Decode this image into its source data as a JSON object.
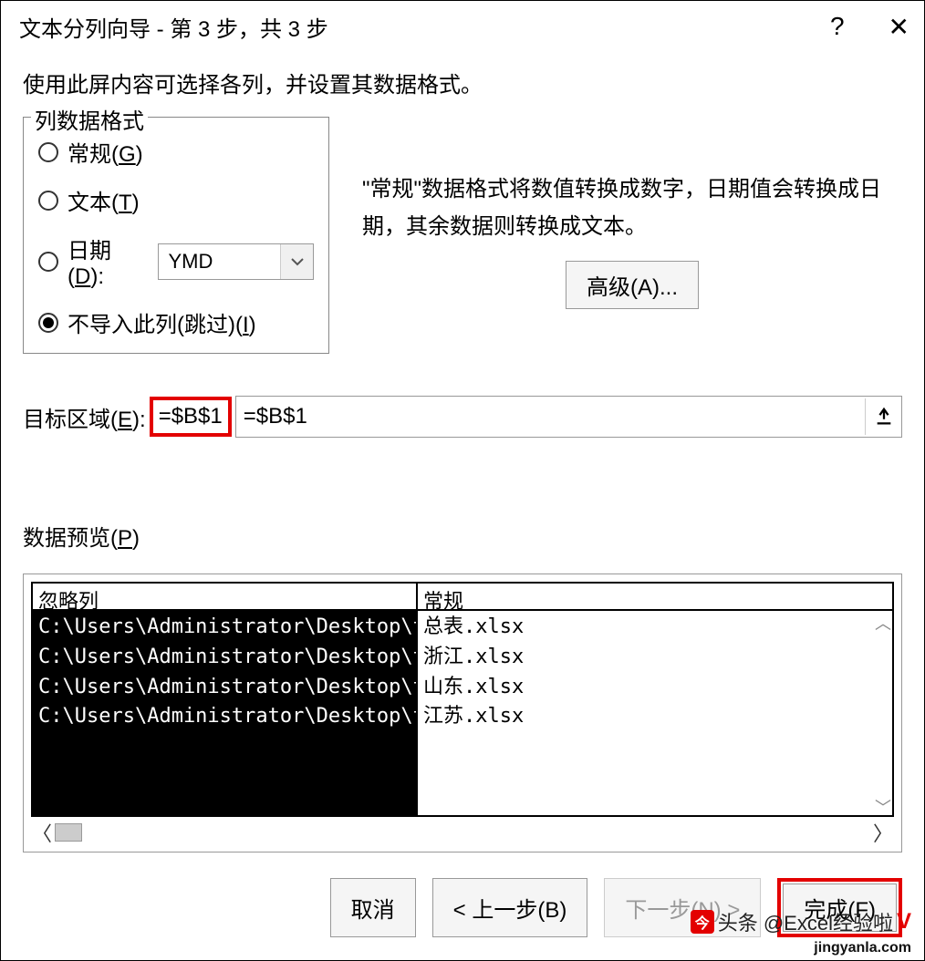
{
  "window": {
    "title": "文本分列向导 - 第 3 步，共 3 步",
    "help_icon": "?",
    "close_icon": "✕"
  },
  "instruction": "使用此屏内容可选择各列，并设置其数据格式。",
  "format_group": {
    "legend": "列数据格式",
    "options": {
      "general": {
        "label_pre": "常规(",
        "hotkey": "G",
        "label_post": ")",
        "selected": false
      },
      "text": {
        "label_pre": "文本(",
        "hotkey": "T",
        "label_post": ")",
        "selected": false
      },
      "date": {
        "label_pre": "日期(",
        "hotkey": "D",
        "label_post": "):",
        "selected": false,
        "dropdown_value": "YMD"
      },
      "skip": {
        "label_pre": "不导入此列(跳过)(",
        "hotkey": "I",
        "label_post": ")",
        "selected": true
      }
    }
  },
  "description": "\"常规\"数据格式将数值转换成数字，日期值会转换成日期，其余数据则转换成文本。",
  "advanced_button": "高级(A)...",
  "target": {
    "label": "目标区域(E):",
    "value": "=$B$1"
  },
  "preview": {
    "label_pre": "数据预览(",
    "hotkey": "P",
    "label_post": ")",
    "columns": [
      {
        "header": "忽略列",
        "rows": [
          "C:\\Users\\Administrator\\Desktop\\temp\\",
          "C:\\Users\\Administrator\\Desktop\\temp\\",
          "C:\\Users\\Administrator\\Desktop\\temp\\",
          "C:\\Users\\Administrator\\Desktop\\temp\\"
        ]
      },
      {
        "header": "常规",
        "rows": [
          "总表.xlsx",
          "浙江.xlsx",
          "山东.xlsx",
          "江苏.xlsx"
        ]
      }
    ]
  },
  "buttons": {
    "cancel": "取消",
    "back": "< 上一步(B)",
    "next": "下一步(N) >",
    "finish": "完成(F)"
  },
  "watermark": {
    "text": "头条 @Excel经验啦",
    "badge": "V",
    "url": "jingyanla.com"
  }
}
